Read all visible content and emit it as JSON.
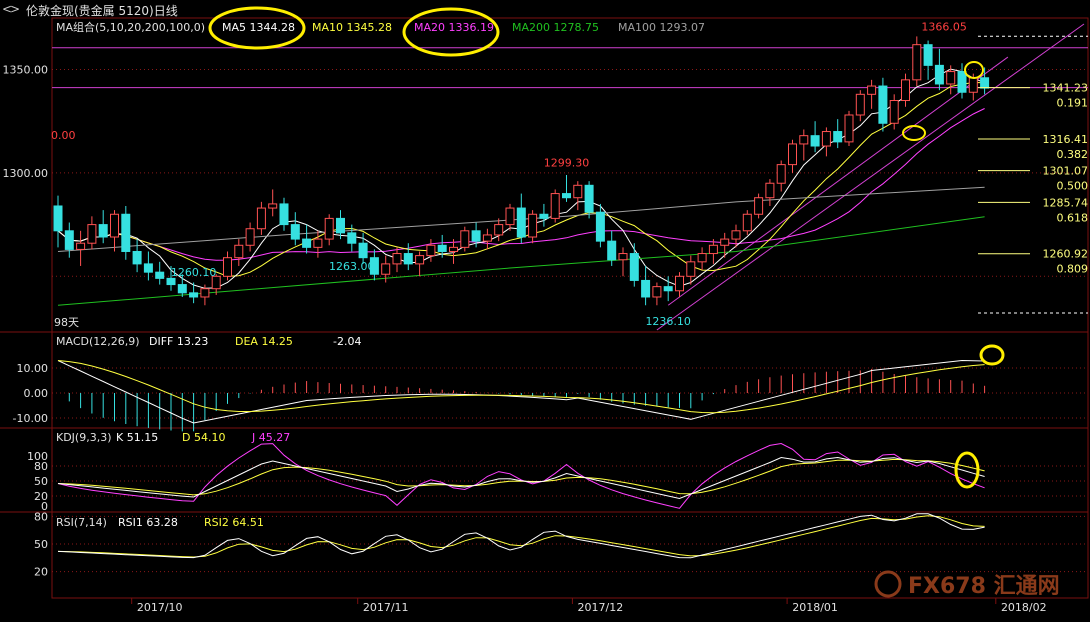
{
  "window": {
    "title": "伦敦金现(贵金属 5120)日线",
    "nav_left": "<",
    "nav_right": ">"
  },
  "colors": {
    "up": "#ff5252",
    "down": "#36e0e0",
    "ma5": "#ffffff",
    "ma10": "#ffff40",
    "ma20": "#ff40ff",
    "ma200": "#20c020",
    "ma100": "#a0a0a0",
    "annotation": "#ffee00"
  },
  "panes": {
    "main": {
      "legend_prefix": "MA组合(5,10,20,200,100,0)",
      "items": [
        {
          "label": "MA5",
          "value": "1344.28"
        },
        {
          "label": "MA10",
          "value": "1345.28"
        },
        {
          "label": "MA20",
          "value": "1336.19"
        },
        {
          "label": "MA200",
          "value": "1278.75"
        },
        {
          "label": "MA100",
          "value": "1293.07"
        }
      ],
      "y_ticks": [
        "1350.00",
        "1300.00"
      ],
      "zero_label": "0.00",
      "days_label": "98天",
      "annotations": [
        {
          "text": "1366.05",
          "color": "#ff4040"
        },
        {
          "text": "1299.30",
          "color": "#ff4040"
        },
        {
          "text": "1260.10",
          "color": "#36e0e0"
        },
        {
          "text": "1263.00",
          "color": "#36e0e0"
        },
        {
          "text": "1236.10",
          "color": "#36e0e0"
        }
      ],
      "fib": [
        {
          "price": "1341.23",
          "ratio": "0.191"
        },
        {
          "price": "1316.41",
          "ratio": "0.382"
        },
        {
          "price": "1301.07",
          "ratio": "0.500"
        },
        {
          "price": "1285.74",
          "ratio": "0.618"
        },
        {
          "price": "1260.92",
          "ratio": "0.809"
        }
      ]
    },
    "macd": {
      "legend_prefix": "MACD(12,26,9)",
      "items": [
        {
          "label": "DIFF",
          "value": "13.23"
        },
        {
          "label": "DEA",
          "value": "14.25"
        },
        {
          "label": "",
          "value": "-2.04"
        }
      ],
      "y_ticks": [
        "10.00",
        "0.00",
        "-10.00"
      ]
    },
    "kdj": {
      "legend_prefix": "KDJ(9,3,3)",
      "items": [
        {
          "label": "K",
          "value": "51.15"
        },
        {
          "label": "D",
          "value": "54.10"
        },
        {
          "label": "J",
          "value": "45.27"
        }
      ],
      "y_ticks": [
        "100",
        "80",
        "50",
        "20",
        "0"
      ]
    },
    "rsi": {
      "legend_prefix": "RSI(7,14)",
      "items": [
        {
          "label": "RSI1",
          "value": "63.28"
        },
        {
          "label": "RSI2",
          "value": "64.51"
        }
      ],
      "y_ticks": [
        "80",
        "50",
        "20"
      ]
    }
  },
  "x_axis": [
    "2017/10",
    "2017/11",
    "2017/12",
    "2018/01",
    "2018/02"
  ],
  "watermark": "FX678 汇通网",
  "chart_data": {
    "type": "candlestick",
    "instrument": "伦敦金现",
    "period": "日线",
    "ylim": [
      1225,
      1372
    ],
    "candles": [
      [
        1284,
        1289,
        1264,
        1272
      ],
      [
        1272,
        1276,
        1259,
        1263
      ],
      [
        1263,
        1272,
        1255,
        1266
      ],
      [
        1266,
        1279,
        1263,
        1275
      ],
      [
        1275,
        1282,
        1266,
        1269
      ],
      [
        1269,
        1282,
        1262,
        1280
      ],
      [
        1280,
        1284,
        1258,
        1262
      ],
      [
        1262,
        1268,
        1252,
        1256
      ],
      [
        1256,
        1262,
        1248,
        1252
      ],
      [
        1252,
        1257,
        1246,
        1249
      ],
      [
        1249,
        1255,
        1243,
        1246
      ],
      [
        1246,
        1251,
        1240,
        1242
      ],
      [
        1242,
        1247,
        1237,
        1240
      ],
      [
        1240,
        1246,
        1236,
        1244
      ],
      [
        1244,
        1251,
        1241,
        1250
      ],
      [
        1250,
        1262,
        1248,
        1259
      ],
      [
        1259,
        1268,
        1255,
        1265
      ],
      [
        1265,
        1276,
        1262,
        1273
      ],
      [
        1273,
        1286,
        1270,
        1283
      ],
      [
        1283,
        1292,
        1279,
        1285
      ],
      [
        1285,
        1288,
        1272,
        1275
      ],
      [
        1275,
        1281,
        1265,
        1268
      ],
      [
        1268,
        1275,
        1261,
        1264
      ],
      [
        1264,
        1272,
        1259,
        1268
      ],
      [
        1268,
        1280,
        1265,
        1278
      ],
      [
        1278,
        1282,
        1268,
        1271
      ],
      [
        1271,
        1275,
        1262,
        1266
      ],
      [
        1266,
        1271,
        1256,
        1259
      ],
      [
        1259,
        1263,
        1248,
        1251
      ],
      [
        1251,
        1260,
        1247,
        1256
      ],
      [
        1256,
        1264,
        1252,
        1261
      ],
      [
        1261,
        1266,
        1253,
        1256
      ],
      [
        1256,
        1262,
        1250,
        1260
      ],
      [
        1260,
        1268,
        1257,
        1265
      ],
      [
        1265,
        1270,
        1259,
        1262
      ],
      [
        1262,
        1268,
        1256,
        1264
      ],
      [
        1264,
        1274,
        1262,
        1272
      ],
      [
        1272,
        1276,
        1264,
        1267
      ],
      [
        1267,
        1273,
        1263,
        1270
      ],
      [
        1270,
        1278,
        1267,
        1275
      ],
      [
        1275,
        1285,
        1272,
        1283
      ],
      [
        1283,
        1290,
        1266,
        1269
      ],
      [
        1269,
        1282,
        1266,
        1280
      ],
      [
        1280,
        1285,
        1274,
        1278
      ],
      [
        1278,
        1292,
        1276,
        1290
      ],
      [
        1290,
        1299,
        1286,
        1288
      ],
      [
        1288,
        1296,
        1282,
        1294
      ],
      [
        1294,
        1296,
        1278,
        1281
      ],
      [
        1281,
        1285,
        1264,
        1267
      ],
      [
        1267,
        1272,
        1255,
        1258
      ],
      [
        1258,
        1264,
        1250,
        1261
      ],
      [
        1261,
        1266,
        1245,
        1248
      ],
      [
        1248,
        1255,
        1236,
        1240
      ],
      [
        1240,
        1247,
        1236,
        1245
      ],
      [
        1245,
        1250,
        1238,
        1243
      ],
      [
        1243,
        1252,
        1240,
        1250
      ],
      [
        1250,
        1260,
        1246,
        1257
      ],
      [
        1257,
        1264,
        1253,
        1261
      ],
      [
        1261,
        1268,
        1256,
        1265
      ],
      [
        1265,
        1271,
        1259,
        1268
      ],
      [
        1268,
        1275,
        1264,
        1272
      ],
      [
        1272,
        1282,
        1270,
        1280
      ],
      [
        1280,
        1290,
        1278,
        1288
      ],
      [
        1288,
        1297,
        1284,
        1295
      ],
      [
        1295,
        1306,
        1291,
        1304
      ],
      [
        1304,
        1316,
        1300,
        1314
      ],
      [
        1314,
        1321,
        1306,
        1318
      ],
      [
        1318,
        1325,
        1310,
        1313
      ],
      [
        1313,
        1322,
        1308,
        1320
      ],
      [
        1320,
        1326,
        1312,
        1315
      ],
      [
        1315,
        1330,
        1313,
        1328
      ],
      [
        1328,
        1340,
        1325,
        1338
      ],
      [
        1338,
        1345,
        1331,
        1342
      ],
      [
        1342,
        1346,
        1320,
        1324
      ],
      [
        1324,
        1338,
        1321,
        1335
      ],
      [
        1335,
        1348,
        1332,
        1345
      ],
      [
        1345,
        1366,
        1342,
        1362
      ],
      [
        1362,
        1364,
        1345,
        1352
      ],
      [
        1352,
        1360,
        1340,
        1343
      ],
      [
        1343,
        1352,
        1338,
        1349
      ],
      [
        1349,
        1353,
        1336,
        1339
      ],
      [
        1339,
        1348,
        1335,
        1346
      ],
      [
        1346,
        1351,
        1338,
        1341
      ]
    ]
  }
}
